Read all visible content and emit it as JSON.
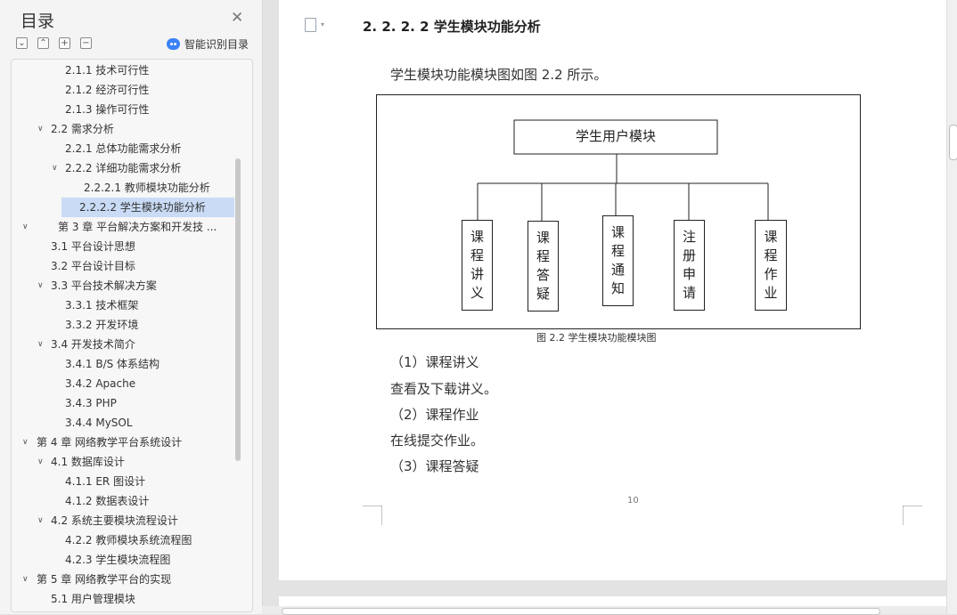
{
  "sidebar": {
    "title": "目录",
    "close_glyph": "✕",
    "smart_label": "智能识别目录",
    "toolbar": [
      "⌄",
      "⌃",
      "+",
      "−"
    ],
    "items": [
      {
        "label": "2.1.1  技术可行性",
        "indent": 2,
        "arrow": ""
      },
      {
        "label": "2.1.2  经济可行性",
        "indent": 2,
        "arrow": ""
      },
      {
        "label": "2.1.3  操作可行性",
        "indent": 2,
        "arrow": ""
      },
      {
        "label": "2.2 需求分析",
        "indent": 1,
        "arrow": "v"
      },
      {
        "label": "2.2.1  总体功能需求分析",
        "indent": 2,
        "arrow": ""
      },
      {
        "label": "2.2.2 详细功能需求分析",
        "indent": 2,
        "arrow": "v"
      },
      {
        "label": "2.2.2.1 教师模块功能分析",
        "indent": 3,
        "arrow": ""
      },
      {
        "label": "2.2.2.2 学生模块功能分析",
        "indent": 3,
        "arrow": "",
        "selected": true
      },
      {
        "label": "第 3 章   平台解决方案和开发技 ...",
        "indent": 0,
        "arrow": "v",
        "wide": true
      },
      {
        "label": "3.1 平台设计思想",
        "indent": 1,
        "arrow": ""
      },
      {
        "label": "3.2 平台设计目标",
        "indent": 1,
        "arrow": ""
      },
      {
        "label": "3.3 平台技术解决方案",
        "indent": 1,
        "arrow": "v"
      },
      {
        "label": "3.3.1  技术框架",
        "indent": 2,
        "arrow": ""
      },
      {
        "label": "3.3.2 开发环境",
        "indent": 2,
        "arrow": ""
      },
      {
        "label": "3.4 开发技术简介",
        "indent": 1,
        "arrow": "v"
      },
      {
        "label": "3.4.1    B/S 体系结构",
        "indent": 2,
        "arrow": ""
      },
      {
        "label": "3.4.2    Apache",
        "indent": 2,
        "arrow": ""
      },
      {
        "label": "3.4.3    PHP",
        "indent": 2,
        "arrow": ""
      },
      {
        "label": "3.4.4 MySOL",
        "indent": 2,
        "arrow": ""
      },
      {
        "label": "第 4 章  网络教学平台系统设计",
        "indent": 0,
        "arrow": "v"
      },
      {
        "label": "4.1 数据库设计",
        "indent": 1,
        "arrow": "v"
      },
      {
        "label": "4.1.1    ER 图设计",
        "indent": 2,
        "arrow": ""
      },
      {
        "label": "4.1.2    数据表设计",
        "indent": 2,
        "arrow": ""
      },
      {
        "label": "4.2 系统主要模块流程设计",
        "indent": 1,
        "arrow": "v"
      },
      {
        "label": "4.2.2 教师模块系统流程图",
        "indent": 2,
        "arrow": ""
      },
      {
        "label": "4.2.3 学生模块流程图",
        "indent": 2,
        "arrow": ""
      },
      {
        "label": "第 5 章  网络教学平台的实现",
        "indent": 0,
        "arrow": "v"
      },
      {
        "label": "5.1 用户管理模块",
        "indent": 1,
        "arrow": ""
      }
    ]
  },
  "document": {
    "heading": "2. 2. 2. 2 学生模块功能分析",
    "intro": "学生模块功能模块图如图 2.2 所示。",
    "diagram": {
      "root": "学生用户模块",
      "modules": [
        "课程讲义",
        "课程答疑",
        "课程通知",
        "注册申请",
        "课程作业"
      ]
    },
    "caption": "图 2.2 学生模块功能模块图",
    "lines": [
      "（1）课程讲义",
      "查看及下载讲义。",
      "（2）课程作业",
      "在线提交作业。",
      "（3）课程答疑"
    ],
    "page_number": "10"
  },
  "colors": {
    "selected": "#c9dbf5",
    "accent": "#3b82f6"
  }
}
